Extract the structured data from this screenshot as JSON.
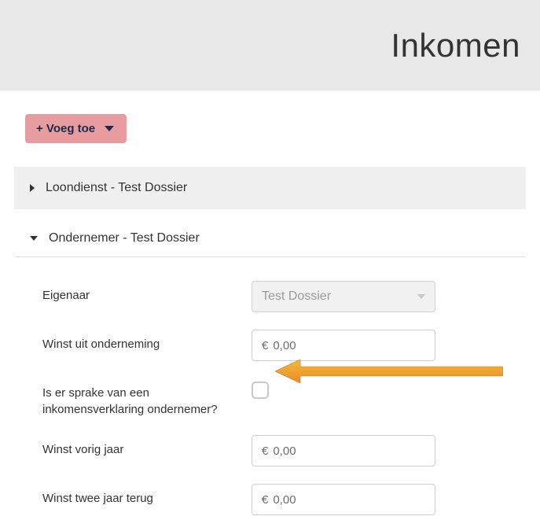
{
  "header": {
    "title": "Inkomen"
  },
  "addButton": {
    "label": "+ Voeg toe"
  },
  "panels": {
    "collapsed": {
      "title": "Loondienst - Test Dossier"
    },
    "expanded": {
      "title": "Ondernemer - Test Dossier"
    }
  },
  "form": {
    "owner": {
      "label": "Eigenaar",
      "selected": "Test Dossier"
    },
    "profit": {
      "label": "Winst uit onderneming",
      "prefix": "€",
      "value": "0,00"
    },
    "declaration": {
      "label": "Is er sprake van een inkomensverklaring ondernemer?"
    },
    "profitPrev": {
      "label": "Winst vorig jaar",
      "prefix": "€",
      "value": "0,00"
    },
    "profitTwo": {
      "label": "Winst twee jaar terug",
      "prefix": "€",
      "value": "0,00"
    }
  }
}
